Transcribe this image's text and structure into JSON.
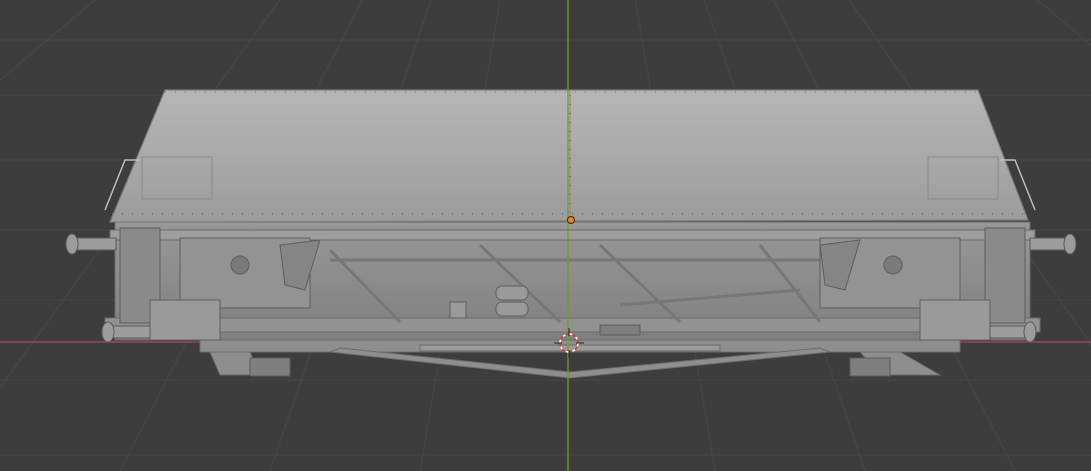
{
  "viewport": {
    "background": "#3d3d3d",
    "grid_color": "#4a4a4a",
    "x_axis_color": "#b04a52",
    "y_axis_color": "#6e9a33"
  },
  "scene": {
    "object": "freight-car-model",
    "shading": "solid",
    "base_color": "#a7a7a7",
    "origin_color": "#e08a1e",
    "cursor_icon": "3d-cursor-icon"
  }
}
